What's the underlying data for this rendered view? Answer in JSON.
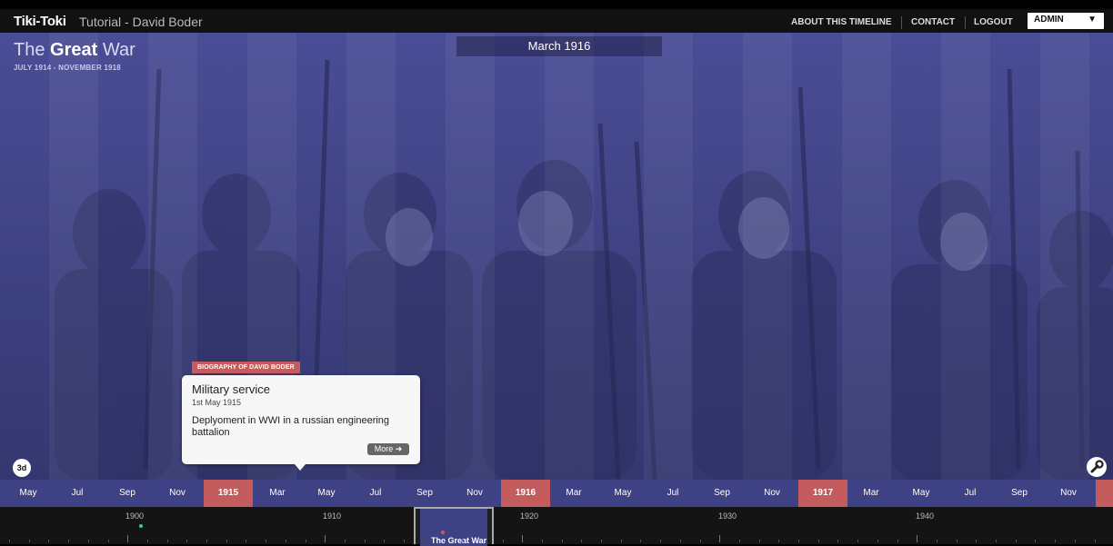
{
  "app": {
    "brand": "Tiki-Toki",
    "timeline_name": "Tutorial - David Boder"
  },
  "nav": {
    "about": "ABOUT THIS TIMELINE",
    "contact": "CONTACT",
    "logout": "LOGOUT",
    "account": "ADMIN",
    "account_caret": "▼"
  },
  "timeline": {
    "title_light": "The",
    "title_bold": "Great",
    "title_end": "War",
    "dates": "JULY 1914 - NOVEMBER 1918",
    "current_date": "March 1916"
  },
  "story": {
    "category": "BIOGRAPHY OF DAVID BODER",
    "title": "Military service",
    "date": "1st May 1915",
    "body": "Deplyoment in WWI in a russian engineering battalion",
    "more": "More ➜"
  },
  "controls": {
    "view_3d": "3d",
    "tools_icon": "wrench-icon"
  },
  "month_band": [
    "May",
    "Jul",
    "Sep",
    "Nov",
    "1915",
    "Mar",
    "May",
    "Jul",
    "Sep",
    "Nov",
    "1916",
    "Mar",
    "May",
    "Jul",
    "Sep",
    "Nov",
    "1917",
    "Mar",
    "May",
    "Jul",
    "Sep",
    "Nov"
  ],
  "year_labels": [
    "1900",
    "1910",
    "1920",
    "1930",
    "1940"
  ],
  "mini_window_label": "The Great War",
  "colors": {
    "accent_red": "#c45c5e",
    "band_blue": "#3e4285",
    "stage_tint": "#3a3d83"
  }
}
